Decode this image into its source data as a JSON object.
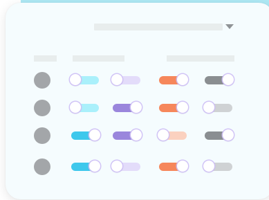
{
  "grid": {
    "rows": [
      {
        "toggles": [
          {
            "color": "cyan",
            "state": "off"
          },
          {
            "color": "purple",
            "state": "off"
          },
          {
            "color": "orange",
            "state": "on"
          },
          {
            "color": "gray",
            "state": "on"
          }
        ]
      },
      {
        "toggles": [
          {
            "color": "cyan",
            "state": "off"
          },
          {
            "color": "purple",
            "state": "on"
          },
          {
            "color": "orange",
            "state": "on"
          },
          {
            "color": "gray",
            "state": "off"
          }
        ]
      },
      {
        "toggles": [
          {
            "color": "cyan",
            "state": "on"
          },
          {
            "color": "purple",
            "state": "on"
          },
          {
            "color": "orange",
            "state": "off"
          },
          {
            "color": "gray",
            "state": "on"
          }
        ]
      },
      {
        "toggles": [
          {
            "color": "cyan",
            "state": "on"
          },
          {
            "color": "purple",
            "state": "off"
          },
          {
            "color": "orange",
            "state": "on"
          },
          {
            "color": "gray",
            "state": "off"
          }
        ]
      }
    ]
  },
  "colors": {
    "cyan": "#3ec8ec",
    "purple": "#9a86dc",
    "orange": "#f6875b",
    "gray": "#8a8e91",
    "avatar": "#a3a6a9",
    "placeholder": "#e8eded",
    "backdrop": "#aee9f5"
  },
  "icons": {
    "filter_dropdown": "chevron-down-icon",
    "avatar": "avatar-placeholder"
  }
}
